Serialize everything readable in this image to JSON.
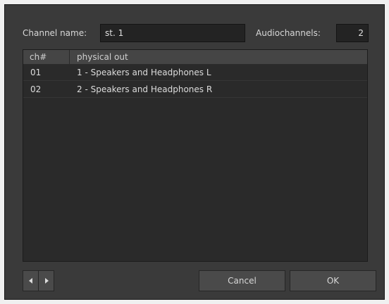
{
  "form": {
    "channel_name_label": "Channel name:",
    "channel_name_value": "st. 1",
    "audiochannels_label": "Audiochannels:",
    "audiochannels_value": "2"
  },
  "table": {
    "columns": [
      "ch#",
      "physical out"
    ],
    "rows": [
      {
        "ch": "01",
        "out": "1 - Speakers and Headphones L"
      },
      {
        "ch": "02",
        "out": "2 - Speakers and Headphones R"
      }
    ]
  },
  "buttons": {
    "prev_icon": "triangle-left-icon",
    "next_icon": "triangle-right-icon",
    "cancel": "Cancel",
    "ok": "OK"
  },
  "colors": {
    "dialog_bg": "#3a3a3a",
    "table_bg": "#2a2a2a",
    "header_bg": "#454545",
    "button_bg": "#4a4a4a",
    "text": "#d2d2d2"
  }
}
